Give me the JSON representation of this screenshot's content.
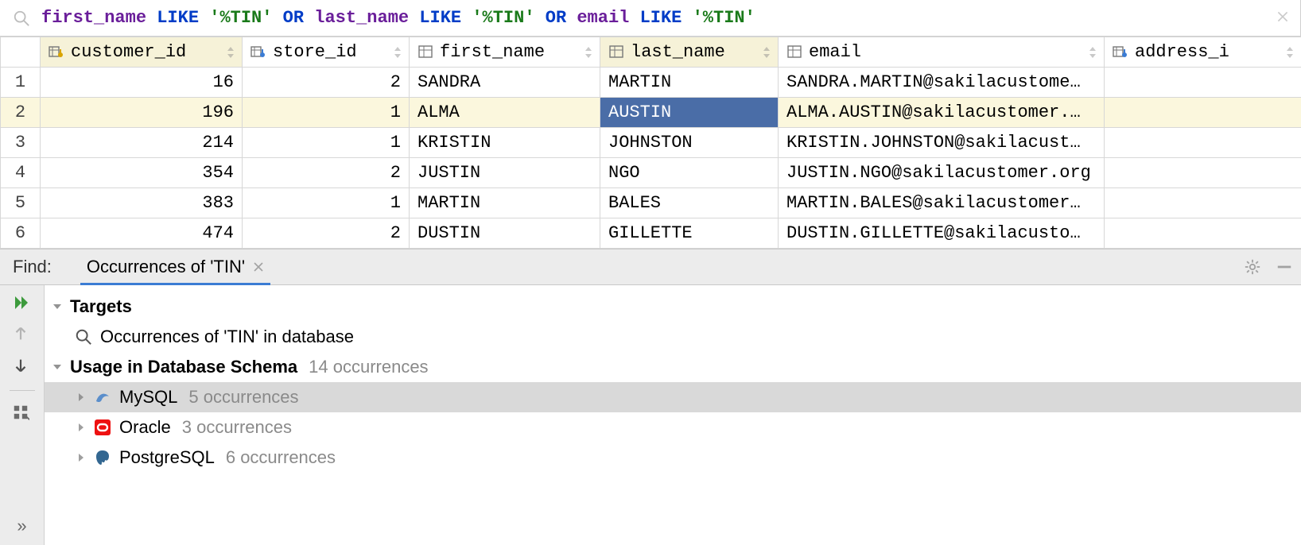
{
  "filter": {
    "tokens": [
      {
        "t": "ident",
        "v": "first_name"
      },
      {
        "t": "sp"
      },
      {
        "t": "kw",
        "v": "LIKE"
      },
      {
        "t": "sp"
      },
      {
        "t": "str",
        "v": "'%TIN'"
      },
      {
        "t": "sp"
      },
      {
        "t": "kw",
        "v": "OR"
      },
      {
        "t": "sp"
      },
      {
        "t": "ident",
        "v": "last_name"
      },
      {
        "t": "sp"
      },
      {
        "t": "kw",
        "v": "LIKE"
      },
      {
        "t": "sp"
      },
      {
        "t": "str",
        "v": "'%TIN'"
      },
      {
        "t": "sp"
      },
      {
        "t": "kw",
        "v": "OR"
      },
      {
        "t": "sp"
      },
      {
        "t": "ident",
        "v": "email"
      },
      {
        "t": "sp"
      },
      {
        "t": "kw",
        "v": "LIKE"
      },
      {
        "t": "sp"
      },
      {
        "t": "str",
        "v": "'%TIN'"
      }
    ]
  },
  "columns": [
    {
      "name": "customer_id",
      "icon": "pk",
      "hl": true
    },
    {
      "name": "store_id",
      "icon": "fk",
      "hl": false
    },
    {
      "name": "first_name",
      "icon": "col",
      "hl": false
    },
    {
      "name": "last_name",
      "icon": "col",
      "hl": true
    },
    {
      "name": "email",
      "icon": "col",
      "hl": false
    },
    {
      "name": "address_id",
      "icon": "fk",
      "hl": false,
      "truncated": "address_i"
    }
  ],
  "rows": [
    {
      "n": 1,
      "customer_id": "16",
      "store_id": "2",
      "first_name": "SANDRA",
      "last_name": "MARTIN",
      "email": "SANDRA.MARTIN@sakilacustome…",
      "hl": false,
      "sel": null
    },
    {
      "n": 2,
      "customer_id": "196",
      "store_id": "1",
      "first_name": "ALMA",
      "last_name": "AUSTIN",
      "email": "ALMA.AUSTIN@sakilacustomer.…",
      "hl": true,
      "sel": "last_name"
    },
    {
      "n": 3,
      "customer_id": "214",
      "store_id": "1",
      "first_name": "KRISTIN",
      "last_name": "JOHNSTON",
      "email": "KRISTIN.JOHNSTON@sakilacust…",
      "hl": false,
      "sel": null
    },
    {
      "n": 4,
      "customer_id": "354",
      "store_id": "2",
      "first_name": "JUSTIN",
      "last_name": "NGO",
      "email": "JUSTIN.NGO@sakilacustomer.org",
      "hl": false,
      "sel": null
    },
    {
      "n": 5,
      "customer_id": "383",
      "store_id": "1",
      "first_name": "MARTIN",
      "last_name": "BALES",
      "email": "MARTIN.BALES@sakilacustomer…",
      "hl": false,
      "sel": null
    },
    {
      "n": 6,
      "customer_id": "474",
      "store_id": "2",
      "first_name": "DUSTIN",
      "last_name": "GILLETTE",
      "email": "DUSTIN.GILLETTE@sakilacusto…",
      "hl": false,
      "sel": null
    }
  ],
  "find": {
    "panel_label": "Find:",
    "tab_label": "Occurrences of 'TIN'",
    "targets_label": "Targets",
    "targets_sub": "Occurrences of 'TIN' in database",
    "usage_label": "Usage in Database Schema",
    "usage_count": "14 occurrences",
    "dbs": [
      {
        "name": "MySQL",
        "count": "5 occurrences",
        "icon": "mysql",
        "selected": true
      },
      {
        "name": "Oracle",
        "count": "3 occurrences",
        "icon": "oracle",
        "selected": false
      },
      {
        "name": "PostgreSQL",
        "count": "6 occurrences",
        "icon": "postgres",
        "selected": false
      }
    ]
  }
}
